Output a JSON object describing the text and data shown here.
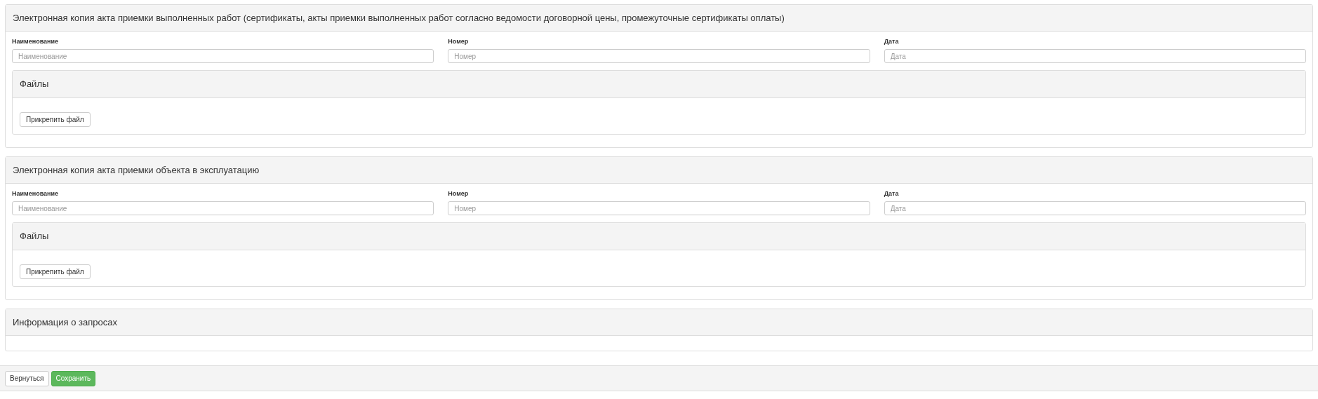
{
  "sections": [
    {
      "title": "Электронная копия акта приемки выполненных работ (сертификаты, акты приемки выполненных работ согласно ведомости договорной цены, промежуточные сертификаты оплаты)",
      "fields": [
        {
          "label": "Наименование",
          "placeholder": "Наименование"
        },
        {
          "label": "Номер",
          "placeholder": "Номер"
        },
        {
          "label": "Дата",
          "placeholder": "Дата"
        }
      ],
      "files": {
        "title": "Файлы",
        "button": "Прикрепить файл"
      }
    },
    {
      "title": "Электронная копия акта приемки объекта в эксплуатацию",
      "fields": [
        {
          "label": "Наименование",
          "placeholder": "Наименование"
        },
        {
          "label": "Номер",
          "placeholder": "Номер"
        },
        {
          "label": "Дата",
          "placeholder": "Дата"
        }
      ],
      "files": {
        "title": "Файлы",
        "button": "Прикрепить файл"
      }
    },
    {
      "title": "Информация о запросах"
    }
  ],
  "footer": {
    "buttons": [
      {
        "label": "Вернуться",
        "kind": "default"
      },
      {
        "label": "Сохранить",
        "kind": "success"
      }
    ]
  }
}
